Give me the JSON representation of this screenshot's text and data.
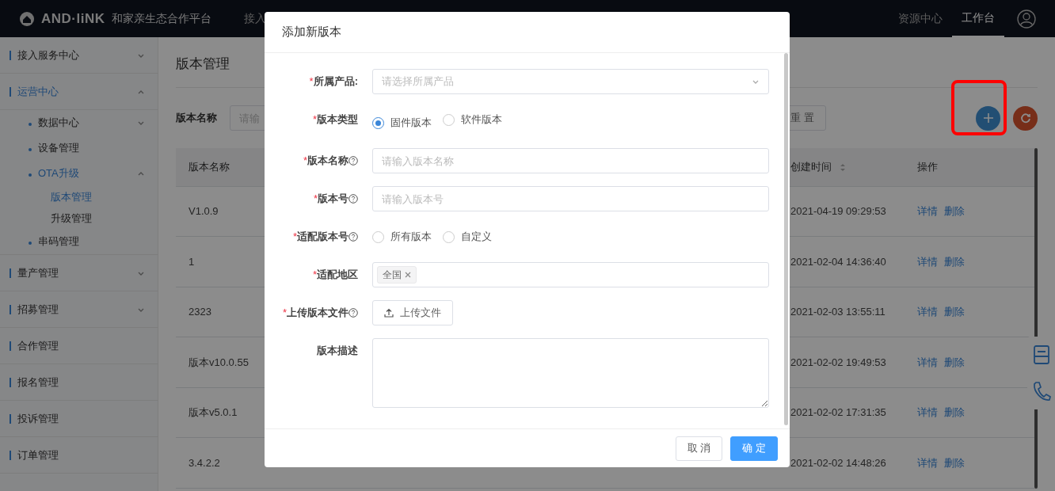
{
  "header": {
    "logo_text": "AND·liNK",
    "platform": "和家亲生态合作平台",
    "nav": [
      {
        "label": "接入"
      }
    ],
    "right_nav": [
      {
        "label": "资源中心",
        "selected": false
      },
      {
        "label": "工作台",
        "selected": true
      }
    ]
  },
  "sidebar": {
    "items": [
      {
        "label": "接入服务中心",
        "kind": "menu",
        "expanded": false,
        "selected": false
      },
      {
        "label": "运营中心",
        "kind": "menu",
        "expanded": true,
        "selected": true,
        "children": [
          {
            "label": "数据中心",
            "kind": "menu",
            "expanded": false,
            "selected": false
          },
          {
            "label": "设备管理",
            "kind": "link",
            "selected": false
          },
          {
            "label": "OTA升级",
            "kind": "menu",
            "expanded": true,
            "selected": true,
            "children": [
              {
                "label": "版本管理",
                "selected": true
              },
              {
                "label": "升级管理",
                "selected": false
              }
            ]
          },
          {
            "label": "串码管理",
            "kind": "link",
            "selected": false
          }
        ]
      },
      {
        "label": "量产管理",
        "kind": "menu",
        "expanded": false,
        "selected": false
      },
      {
        "label": "招募管理",
        "kind": "menu",
        "expanded": false,
        "selected": false
      },
      {
        "label": "合作管理",
        "kind": "link",
        "selected": false
      },
      {
        "label": "报名管理",
        "kind": "link",
        "selected": false
      },
      {
        "label": "投诉管理",
        "kind": "link",
        "selected": false
      },
      {
        "label": "订单管理",
        "kind": "link",
        "selected": false
      }
    ]
  },
  "page": {
    "title": "版本管理",
    "filter_label": "版本名称",
    "filter_placeholder": "请输",
    "reset_button": "重 置",
    "table": {
      "columns": [
        {
          "label": "版本名称",
          "sortable": false
        },
        {
          "label": "创建时间",
          "sortable": true
        },
        {
          "label": "操作",
          "sortable": false
        }
      ],
      "rows": [
        {
          "name": "V1.0.9",
          "created": "2021-04-19 09:29:53",
          "actions": [
            "详情",
            "删除"
          ]
        },
        {
          "name": "1",
          "created": "2021-02-04 14:36:40",
          "actions": [
            "详情",
            "删除"
          ]
        },
        {
          "name": "2323",
          "created": "2021-02-03 13:55:11",
          "actions": [
            "详情",
            "删除"
          ]
        },
        {
          "name": "版本v10.0.55",
          "created": "2021-02-02 19:49:53",
          "actions": [
            "详情",
            "删除"
          ]
        },
        {
          "name": "版本v5.0.1",
          "created": "2021-02-02 17:31:35",
          "actions": [
            "详情",
            "删除"
          ]
        },
        {
          "name": "3.4.2.2",
          "created": "2021-02-02 14:48:26",
          "actions": [
            "详情",
            "删除"
          ]
        }
      ]
    }
  },
  "modal": {
    "title": "添加新版本",
    "required_mark": "*",
    "fields": [
      {
        "kind": "select",
        "label": "所属产品:",
        "required": true,
        "help": false,
        "placeholder": "请选择所属产品"
      },
      {
        "kind": "radio",
        "label": "版本类型",
        "required": true,
        "help": false,
        "options": [
          {
            "label": "固件版本",
            "selected": true
          },
          {
            "label": "软件版本",
            "selected": false
          }
        ]
      },
      {
        "kind": "text",
        "label": "版本名称",
        "required": true,
        "help": true,
        "placeholder": "请输入版本名称"
      },
      {
        "kind": "text",
        "label": "版本号",
        "required": true,
        "help": true,
        "placeholder": "请输入版本号"
      },
      {
        "kind": "radio",
        "label": "适配版本号",
        "required": true,
        "help": true,
        "options": [
          {
            "label": "所有版本",
            "selected": false
          },
          {
            "label": "自定义",
            "selected": false
          }
        ]
      },
      {
        "kind": "tags",
        "label": "适配地区",
        "required": true,
        "help": false,
        "tags": [
          "全国"
        ]
      },
      {
        "kind": "upload",
        "label": "上传版本文件",
        "required": true,
        "help": true,
        "button": "上传文件"
      },
      {
        "kind": "textarea",
        "label": "版本描述",
        "required": false,
        "help": false
      }
    ],
    "buttons": [
      {
        "label": "取 消",
        "kind": "cancel"
      },
      {
        "label": "确 定",
        "kind": "primary"
      }
    ]
  }
}
